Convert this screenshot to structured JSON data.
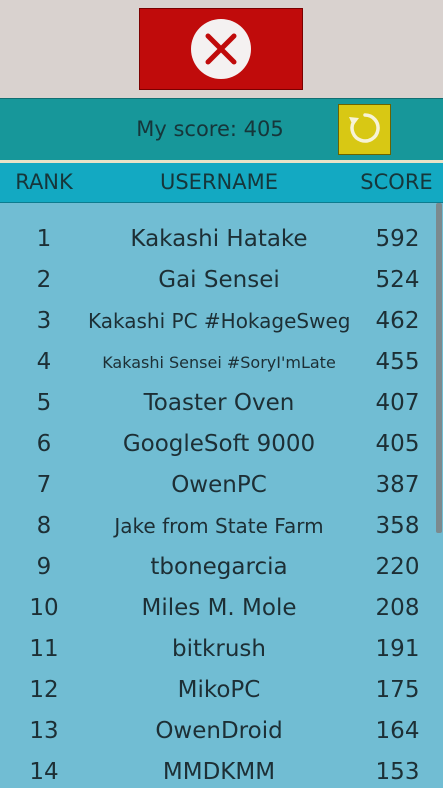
{
  "colors": {
    "close_button": "#c00b0b",
    "score_bar": "#17979a",
    "header_row": "#13a9c2",
    "list_background": "#71bdd3",
    "refresh_button": "#d8c814"
  },
  "top": {
    "close_icon": "close-icon"
  },
  "score": {
    "text": "My score: 405",
    "refresh_icon": "refresh-icon"
  },
  "header": {
    "rank": "RANK",
    "username": "USERNAME",
    "score": "SCORE"
  },
  "leaderboard": [
    {
      "rank": "1",
      "username": "Kakashi Hatake",
      "score": "592"
    },
    {
      "rank": "2",
      "username": "Gai Sensei",
      "score": "524"
    },
    {
      "rank": "3",
      "username": "Kakashi PC #HokageSweg",
      "score": "462"
    },
    {
      "rank": "4",
      "username": "Kakashi Sensei #SoryI'mLate",
      "score": "455"
    },
    {
      "rank": "5",
      "username": "Toaster Oven",
      "score": "407"
    },
    {
      "rank": "6",
      "username": "GoogleSoft 9000",
      "score": "405"
    },
    {
      "rank": "7",
      "username": "OwenPC",
      "score": "387"
    },
    {
      "rank": "8",
      "username": "Jake from State Farm",
      "score": "358"
    },
    {
      "rank": "9",
      "username": "tbonegarcia",
      "score": "220"
    },
    {
      "rank": "10",
      "username": "Miles M. Mole",
      "score": "208"
    },
    {
      "rank": "11",
      "username": "bitkrush",
      "score": "191"
    },
    {
      "rank": "12",
      "username": "MikoPC",
      "score": "175"
    },
    {
      "rank": "13",
      "username": "OwenDroid",
      "score": "164"
    },
    {
      "rank": "14",
      "username": "MMDKMM",
      "score": "153"
    }
  ]
}
